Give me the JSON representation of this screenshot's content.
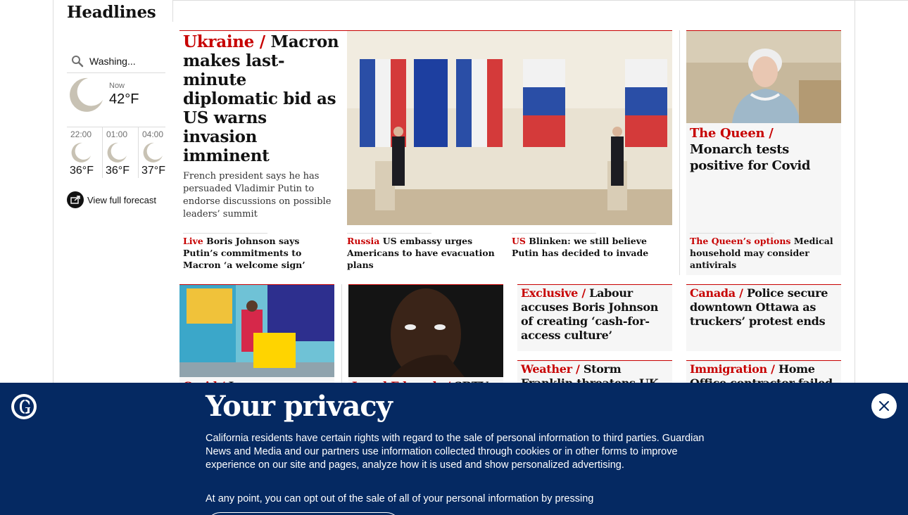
{
  "section": {
    "title": "Headlines"
  },
  "weather": {
    "location": "Washing...",
    "now_label": "Now",
    "now_temp": "42°F",
    "hours": [
      {
        "time": "22:00",
        "temp": "36°F",
        "icon": "moon-icon"
      },
      {
        "time": "01:00",
        "temp": "36°F",
        "icon": "moon-icon"
      },
      {
        "time": "04:00",
        "temp": "37°F",
        "icon": "moon-icon"
      }
    ],
    "forecast_link": "View full forecast"
  },
  "main_story": {
    "kicker": "Ukraine /",
    "headline": "Macron makes last-minute diplomatic bid as US warns invasion imminent",
    "standfirst": "French president says he has persuaded Vladimir Putin to endorse discussions on possible leaders’ summit",
    "sublinks": [
      {
        "kicker": "Live",
        "text": "Boris Johnson says Putin’s commitments to Macron ‘a welcome sign’"
      },
      {
        "kicker": "Russia",
        "text": "US embassy urges Americans to have evacuation plans"
      },
      {
        "kicker": "US",
        "text": "Blinken: we still believe Putin has decided to invade"
      }
    ]
  },
  "queen_story": {
    "kicker": "The Queen /",
    "headline": "Monarch tests positive for Covid",
    "sublink": {
      "kicker": "The Queen’s options",
      "text": "Medical household may consider antivirals"
    }
  },
  "row2": [
    {
      "kicker": "Covid /",
      "headline": "Jo..."
    },
    {
      "kicker": "Jamal Edwards /",
      "headline": "SBTV..."
    },
    {
      "kicker": "Exclusive /",
      "headline": "Labour accuses Boris Johnson of creating ‘cash-for-access culture’"
    },
    {
      "kicker": "Canada /",
      "headline": "Police secure downtown Ottawa as truckers’ protest ends"
    },
    {
      "kicker": "Weather /",
      "headline": "Storm Franklin threatens UK with more"
    },
    {
      "kicker": "Immigration /",
      "headline": "Home Office contractor failed to"
    }
  ],
  "privacy": {
    "title": "Your privacy",
    "body1": "California residents have certain rights with regard to the sale of personal information to third parties. Guardian News and Media and our partners use information collected through cookies or in other forms to improve experience on our site and pages, analyze how it is used and show personalized advertising.",
    "body2": "At any point, you can opt out of the sale of all of your personal information by pressing"
  },
  "colors": {
    "accent": "#c70000",
    "banner": "#052962"
  }
}
